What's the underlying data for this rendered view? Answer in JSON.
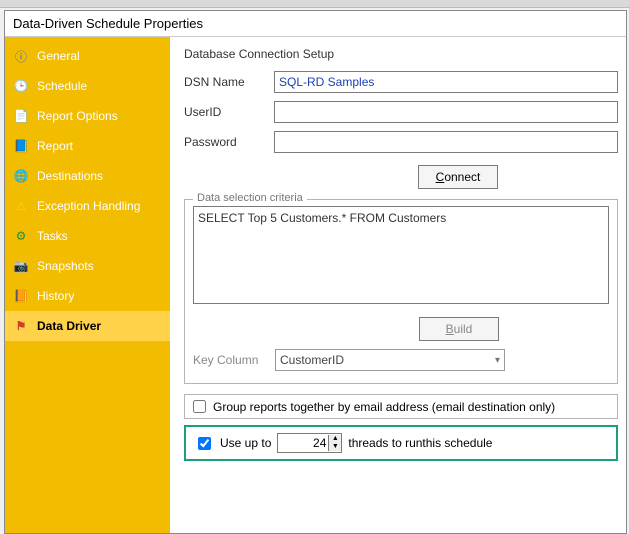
{
  "window": {
    "title": "Data-Driven Schedule Properties"
  },
  "sidebar": {
    "items": [
      {
        "label": "General",
        "icon": "info-icon"
      },
      {
        "label": "Schedule",
        "icon": "clock-icon"
      },
      {
        "label": "Report Options",
        "icon": "options-icon"
      },
      {
        "label": "Report",
        "icon": "report-icon"
      },
      {
        "label": "Destinations",
        "icon": "destinations-icon"
      },
      {
        "label": "Exception Handling",
        "icon": "warning-icon"
      },
      {
        "label": "Tasks",
        "icon": "tasks-icon"
      },
      {
        "label": "Snapshots",
        "icon": "camera-icon"
      },
      {
        "label": "History",
        "icon": "history-icon"
      },
      {
        "label": "Data Driver",
        "icon": "data-driver-icon"
      }
    ],
    "active_index": 9
  },
  "conn": {
    "title": "Database Connection Setup",
    "dsn_label": "DSN Name",
    "dsn_value": "SQL-RD Samples",
    "userid_label": "UserID",
    "userid_value": "",
    "password_label": "Password",
    "password_value": "",
    "connect_label": "Connect"
  },
  "criteria": {
    "legend": "Data selection criteria",
    "sql": "SELECT Top 5 Customers.* FROM Customers",
    "build_label": "Build",
    "keycol_label": "Key Column",
    "keycol_value": "CustomerID"
  },
  "group": {
    "checked": false,
    "label": "Group reports together by email address (email destination only)"
  },
  "threads": {
    "checked": true,
    "prefix": "Use up to",
    "value": "24",
    "suffix": "threads to runthis schedule"
  }
}
